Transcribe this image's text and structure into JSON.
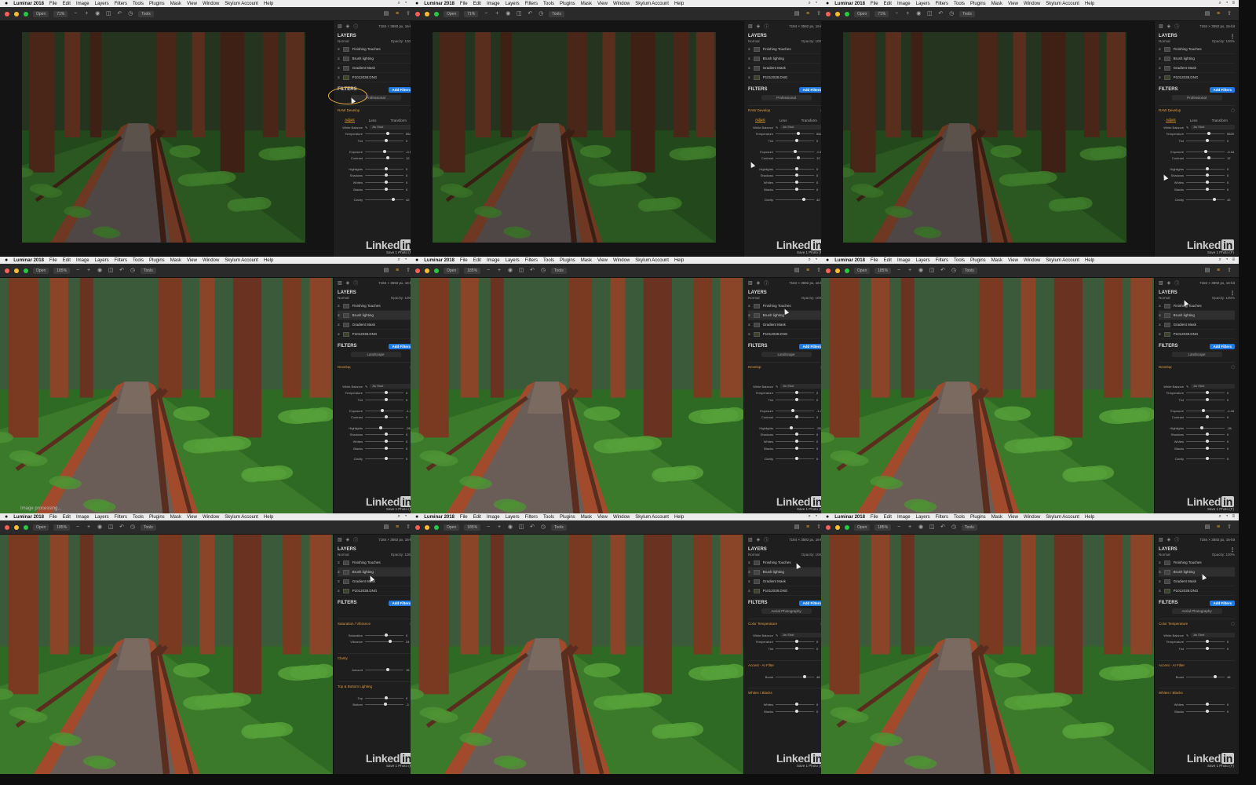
{
  "menubar": {
    "apple": "",
    "app_name": "Luminar 2018",
    "items": [
      "File",
      "Edit",
      "Image",
      "Layers",
      "Filters",
      "Tools",
      "Plugins",
      "Mask",
      "View",
      "Window",
      "Skylum Account",
      "Help"
    ]
  },
  "toolbar": {
    "open_label": "Open",
    "tools_label": "Tools"
  },
  "image_info": "7184 × 3592 px, 16-bit",
  "panel": {
    "layers_title": "LAYERS",
    "blend_label": "Normal",
    "opacity_label": "Opacity: 100%",
    "layers": [
      "Finishing Touches",
      "Brush lighting",
      "Gradient Mask",
      "P1012038.DNG"
    ],
    "filters_title": "FILTERS",
    "add_filters_label": "Add Filters"
  },
  "frames": [
    {
      "zoom": "71%",
      "preset": "Professional",
      "filter_title": "RAW Develop",
      "tabs": [
        "Adjust",
        "Lens",
        "Transform"
      ],
      "controls": [
        {
          "label": "White Balance",
          "dropdown": "As Shot"
        },
        {
          "label": "Temperature",
          "value": "5529",
          "pos": 0.55
        },
        {
          "label": "Tint",
          "value": "0",
          "pos": 0.5
        },
        {
          "gap": true
        },
        {
          "label": "Exposure",
          "value": "-0.16",
          "pos": 0.47
        },
        {
          "label": "Contrast",
          "value": "12",
          "pos": 0.56
        },
        {
          "gap": true
        },
        {
          "label": "Highlights",
          "value": "0",
          "pos": 0.5
        },
        {
          "label": "Shadows",
          "value": "0",
          "pos": 0.5
        },
        {
          "label": "Whites",
          "value": "0",
          "pos": 0.5
        },
        {
          "label": "Blacks",
          "value": "0",
          "pos": 0.5
        },
        {
          "gap": true
        },
        {
          "label": "Clarity",
          "value": "42",
          "pos": 0.7
        }
      ]
    },
    {
      "zoom": "71%",
      "preset": "Professional",
      "filter_title": "RAW Develop",
      "tabs": [
        "Adjust",
        "Lens",
        "Transform"
      ],
      "controls": [
        {
          "label": "White Balance",
          "dropdown": "As Shot"
        },
        {
          "label": "Temperature",
          "value": "5529",
          "pos": 0.55
        },
        {
          "label": "Tint",
          "value": "0",
          "pos": 0.5
        },
        {
          "gap": true
        },
        {
          "label": "Exposure",
          "value": "-0.16",
          "pos": 0.47
        },
        {
          "label": "Contrast",
          "value": "12",
          "pos": 0.56
        },
        {
          "gap": true
        },
        {
          "label": "Highlights",
          "value": "0",
          "pos": 0.5
        },
        {
          "label": "Shadows",
          "value": "0",
          "pos": 0.5
        },
        {
          "label": "Whites",
          "value": "0",
          "pos": 0.5
        },
        {
          "label": "Blacks",
          "value": "0",
          "pos": 0.5
        },
        {
          "gap": true
        },
        {
          "label": "Clarity",
          "value": "42",
          "pos": 0.7
        }
      ]
    },
    {
      "zoom": "71%",
      "preset": "Professional",
      "filter_title": "RAW Develop",
      "tabs": [
        "Adjust",
        "Lens",
        "Transform"
      ],
      "controls": [
        {
          "label": "White Balance",
          "dropdown": "As Shot"
        },
        {
          "label": "Temperature",
          "value": "5529",
          "pos": 0.55
        },
        {
          "label": "Tint",
          "value": "0",
          "pos": 0.5
        },
        {
          "gap": true
        },
        {
          "label": "Exposure",
          "value": "-0.16",
          "pos": 0.47
        },
        {
          "label": "Contrast",
          "value": "12",
          "pos": 0.56
        },
        {
          "gap": true
        },
        {
          "label": "Highlights",
          "value": "0",
          "pos": 0.5
        },
        {
          "label": "Shadows",
          "value": "0",
          "pos": 0.5
        },
        {
          "label": "Whites",
          "value": "0",
          "pos": 0.5
        },
        {
          "label": "Blacks",
          "value": "0",
          "pos": 0.5
        },
        {
          "gap": true
        },
        {
          "label": "Clarity",
          "value": "42",
          "pos": 0.7
        }
      ]
    },
    {
      "zoom": "185%",
      "preset": "Landscape",
      "filter_title": "Develop",
      "controls": [
        {
          "gap": true
        },
        {
          "gap": true
        },
        {
          "gap": true
        },
        {
          "label": "White Balance",
          "dropdown": "As Shot"
        },
        {
          "label": "Temperature",
          "value": "0",
          "pos": 0.5
        },
        {
          "label": "Tint",
          "value": "0",
          "pos": 0.5
        },
        {
          "gap": true
        },
        {
          "label": "Exposure",
          "value": "-1.44",
          "pos": 0.4
        },
        {
          "label": "Contrast",
          "value": "0",
          "pos": 0.5
        },
        {
          "gap": true
        },
        {
          "label": "Highlights",
          "value": "-26",
          "pos": 0.37
        },
        {
          "label": "Shadows",
          "value": "0",
          "pos": 0.5
        },
        {
          "label": "Whites",
          "value": "0",
          "pos": 0.5
        },
        {
          "label": "Blacks",
          "value": "0",
          "pos": 0.5
        },
        {
          "gap": true
        },
        {
          "label": "Clarity",
          "value": "0",
          "pos": 0.5
        }
      ],
      "status": "Image processing..."
    },
    {
      "zoom": "185%",
      "preset": "Landscape",
      "filter_title": "Develop",
      "controls": [
        {
          "gap": true
        },
        {
          "gap": true
        },
        {
          "gap": true
        },
        {
          "label": "White Balance",
          "dropdown": "As Shot"
        },
        {
          "label": "Temperature",
          "value": "0",
          "pos": 0.5
        },
        {
          "label": "Tint",
          "value": "0",
          "pos": 0.5
        },
        {
          "gap": true
        },
        {
          "label": "Exposure",
          "value": "-1.44",
          "pos": 0.4
        },
        {
          "label": "Contrast",
          "value": "0",
          "pos": 0.5
        },
        {
          "gap": true
        },
        {
          "label": "Highlights",
          "value": "-26",
          "pos": 0.37
        },
        {
          "label": "Shadows",
          "value": "0",
          "pos": 0.5
        },
        {
          "label": "Whites",
          "value": "0",
          "pos": 0.5
        },
        {
          "label": "Blacks",
          "value": "0",
          "pos": 0.5
        },
        {
          "gap": true
        },
        {
          "label": "Clarity",
          "value": "0",
          "pos": 0.5
        }
      ]
    },
    {
      "zoom": "185%",
      "preset": "Landscape",
      "filter_title": "Develop",
      "controls": [
        {
          "gap": true
        },
        {
          "gap": true
        },
        {
          "gap": true
        },
        {
          "label": "White Balance",
          "dropdown": "As Shot"
        },
        {
          "label": "Temperature",
          "value": "0",
          "pos": 0.5
        },
        {
          "label": "Tint",
          "value": "0",
          "pos": 0.5
        },
        {
          "gap": true
        },
        {
          "label": "Exposure",
          "value": "-1.44",
          "pos": 0.4
        },
        {
          "label": "Contrast",
          "value": "0",
          "pos": 0.5
        },
        {
          "gap": true
        },
        {
          "label": "Highlights",
          "value": "-26",
          "pos": 0.37
        },
        {
          "label": "Shadows",
          "value": "0",
          "pos": 0.5
        },
        {
          "label": "Whites",
          "value": "0",
          "pos": 0.5
        },
        {
          "label": "Blacks",
          "value": "0",
          "pos": 0.5
        },
        {
          "gap": true
        },
        {
          "label": "Clarity",
          "value": "0",
          "pos": 0.5
        }
      ]
    },
    {
      "zoom": "185%",
      "filter_title": "Saturation / Vibrance",
      "controls": [
        {
          "gap": true
        },
        {
          "label": "Saturation",
          "value": "0",
          "pos": 0.5
        },
        {
          "label": "Vibrance",
          "value": "24",
          "pos": 0.62
        },
        {
          "gap": true
        },
        {
          "gap": true
        },
        {
          "section": "Clarity"
        },
        {
          "gap": true
        },
        {
          "label": "Amount",
          "value": "15",
          "pos": 0.55
        },
        {
          "gap": true
        },
        {
          "gap": true
        },
        {
          "section": "Top & Bottom Lighting"
        },
        {
          "gap": true
        },
        {
          "label": "Top",
          "value": "0",
          "pos": 0.5
        },
        {
          "label": "Bottom",
          "value": "-3",
          "pos": 0.48
        }
      ]
    },
    {
      "zoom": "185%",
      "preset": "Aerial Photography",
      "filter_title": "Color Temperature",
      "controls": [
        {
          "gap": true
        },
        {
          "label": "White Balance",
          "dropdown": "As Shot"
        },
        {
          "label": "Temperature",
          "value": "0",
          "pos": 0.5
        },
        {
          "label": "Tint",
          "value": "0",
          "pos": 0.5
        },
        {
          "gap": true
        },
        {
          "gap": true
        },
        {
          "section": "Accent - AI Filter"
        },
        {
          "gap": true
        },
        {
          "label": "Boost",
          "value": "48",
          "pos": 0.72
        },
        {
          "gap": true
        },
        {
          "gap": true
        },
        {
          "section": "Whites / Blacks"
        },
        {
          "gap": true
        },
        {
          "label": "Whites",
          "value": "0",
          "pos": 0.5
        },
        {
          "label": "Blacks",
          "value": "0",
          "pos": 0.5
        }
      ]
    },
    {
      "zoom": "185%",
      "preset": "Aerial Photography",
      "filter_title": "Color Temperature",
      "controls": [
        {
          "gap": true
        },
        {
          "label": "White Balance",
          "dropdown": "As Shot"
        },
        {
          "label": "Temperature",
          "value": "0",
          "pos": 0.5
        },
        {
          "label": "Tint",
          "value": "0",
          "pos": 0.5
        },
        {
          "gap": true
        },
        {
          "gap": true
        },
        {
          "section": "Accent - AI Filter"
        },
        {
          "gap": true
        },
        {
          "label": "Boost",
          "value": "48",
          "pos": 0.72
        },
        {
          "gap": true
        },
        {
          "gap": true
        },
        {
          "section": "Whites / Blacks"
        },
        {
          "gap": true
        },
        {
          "label": "Whites",
          "value": "0",
          "pos": 0.5
        },
        {
          "label": "Blacks",
          "value": "0",
          "pos": 0.5
        }
      ]
    }
  ],
  "watermark": {
    "brand_left": "Linked",
    "brand_box": "in",
    "subtitle": "Save 1 Photo (F)"
  },
  "colors": {
    "accent": "#e5a125",
    "add_filters": "#1e7be5",
    "callout": "#f0b040"
  }
}
